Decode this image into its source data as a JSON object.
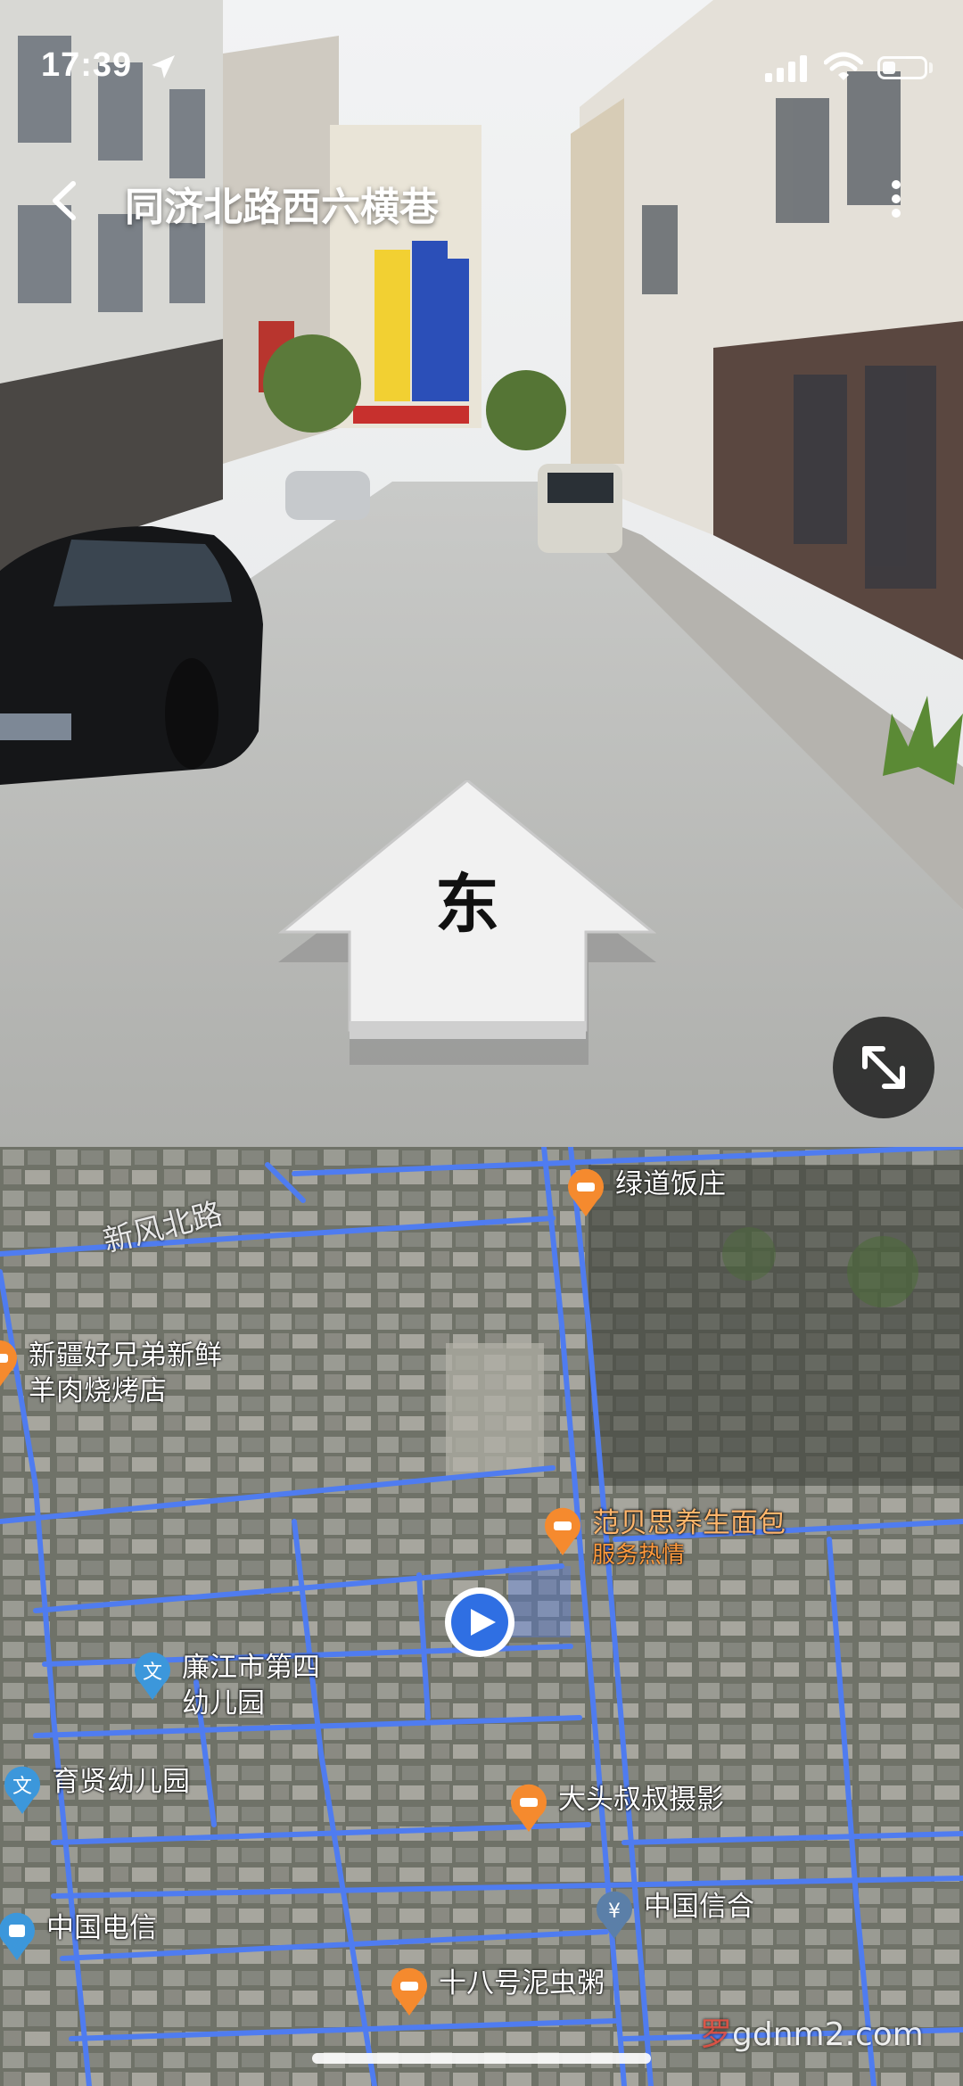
{
  "status_bar": {
    "time": "17:39"
  },
  "header": {
    "title": "同济北路西六横巷"
  },
  "street_view": {
    "direction_label": "东"
  },
  "map": {
    "street_labels": [
      {
        "text": "新风北路"
      }
    ],
    "pois": [
      {
        "name": "绿道饭庄",
        "icon": "restaurant-pin-icon",
        "color": "#f58a2e"
      },
      {
        "name": "新疆好兄弟新鲜",
        "name2": "羊肉烧烤店",
        "icon": "restaurant-pin-icon",
        "color": "#f58a2e"
      },
      {
        "name": "范贝思养生面包",
        "sub": "服务热情",
        "icon": "bakery-pin-icon",
        "color": "#f58a2e"
      },
      {
        "name": "廉江市第四",
        "name2": "幼儿园",
        "icon": "school-pin-icon",
        "color": "#3c97db"
      },
      {
        "name": "育贤幼儿园",
        "icon": "school-pin-icon",
        "color": "#3c97db"
      },
      {
        "name": "大头叔叔摄影",
        "icon": "shop-pin-icon",
        "color": "#f58a2e"
      },
      {
        "name": "中国电信",
        "icon": "telecom-pin-icon",
        "color": "#3c97db"
      },
      {
        "name": "中国信合",
        "icon": "bank-pin-icon",
        "color": "#5b7fa8"
      },
      {
        "name": "十八号泥虫粥",
        "icon": "restaurant-pin-icon",
        "color": "#f58a2e"
      }
    ],
    "watermark": {
      "part1": "罗",
      "part2": "gdnm2.com"
    }
  },
  "colors": {
    "road_line": "#4f7cf0",
    "pin_orange": "#f58a2e",
    "pin_blue": "#3c97db",
    "location_blue": "#2f6fe3"
  }
}
